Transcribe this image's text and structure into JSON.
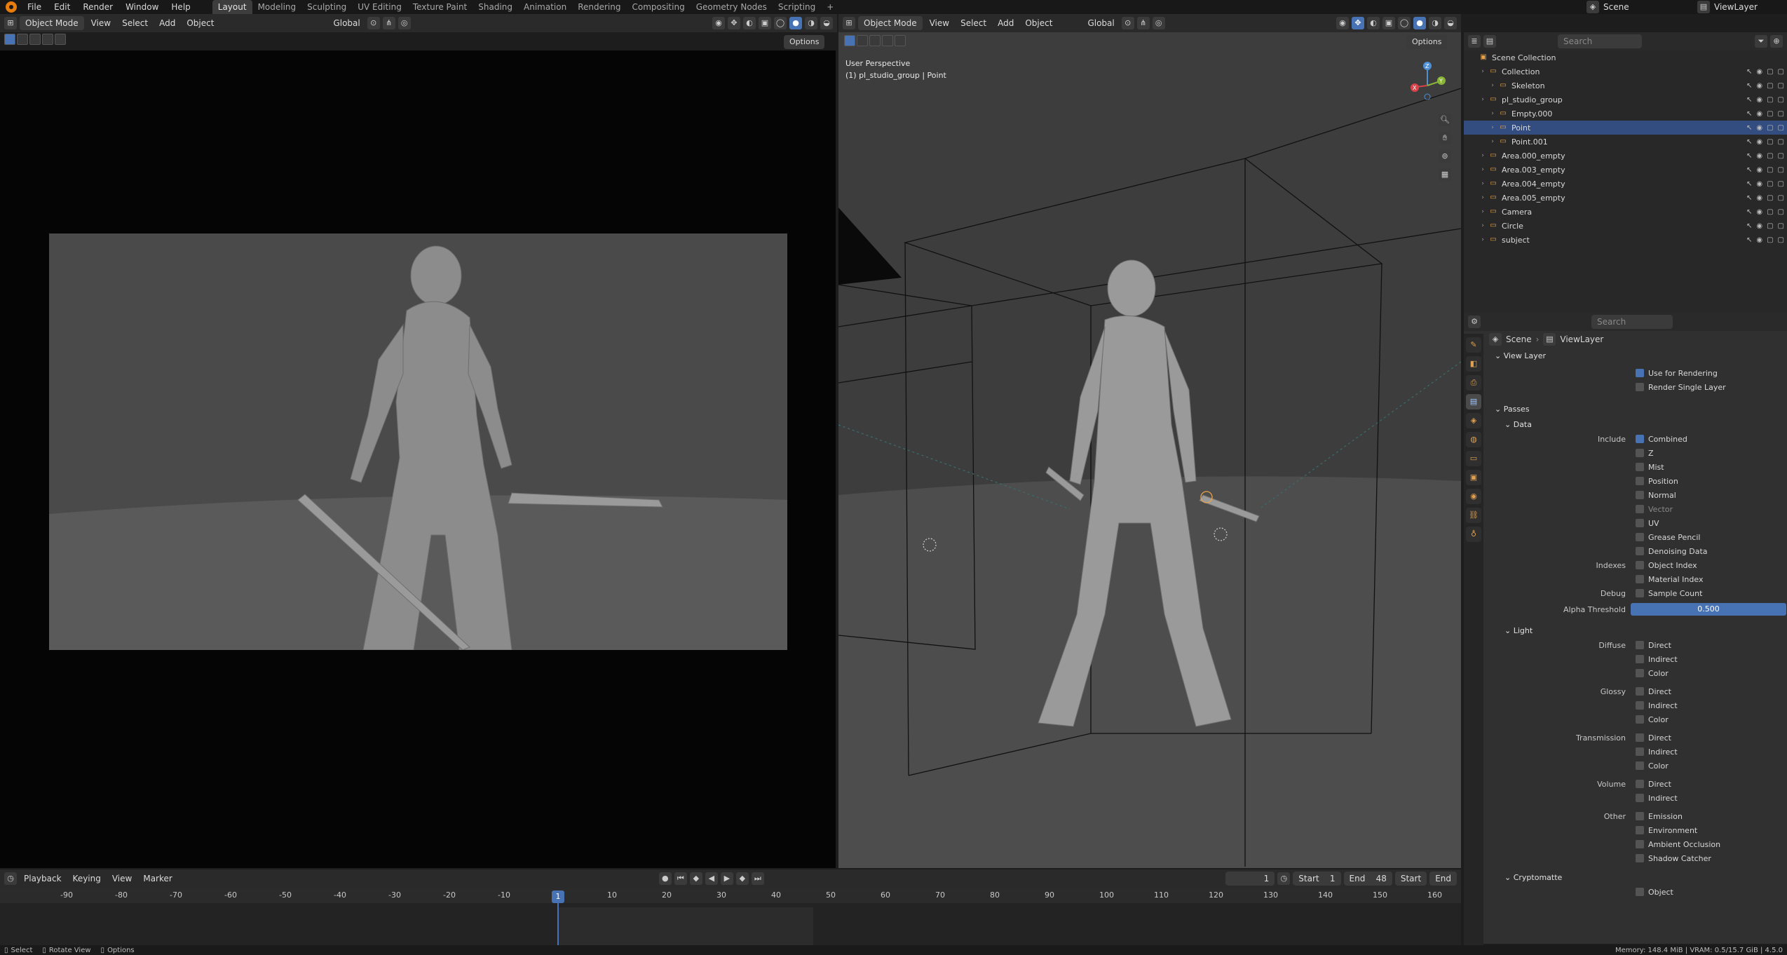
{
  "topbar": {
    "menus": [
      "File",
      "Edit",
      "Render",
      "Window",
      "Help"
    ],
    "workspaces": [
      "Layout",
      "Modeling",
      "Sculpting",
      "UV Editing",
      "Texture Paint",
      "Shading",
      "Animation",
      "Rendering",
      "Compositing",
      "Geometry Nodes",
      "Scripting"
    ],
    "active_workspace": "Layout",
    "add_tab": "+",
    "scene": "Scene",
    "view_layer": "ViewLayer"
  },
  "left_viewport": {
    "mode": "Object Mode",
    "menus": [
      "View",
      "Select",
      "Add",
      "Object"
    ],
    "transform": "Global",
    "options": "Options"
  },
  "right_viewport": {
    "mode": "Object Mode",
    "menus": [
      "View",
      "Select",
      "Add",
      "Object"
    ],
    "transform": "Global",
    "options": "Options",
    "overlay_line1": "User Perspective",
    "overlay_line2": "(1) pl_studio_group | Point",
    "gizmo": {
      "z": "Z",
      "y": "Y",
      "x": "X"
    }
  },
  "outliner": {
    "search_placeholder": "Search",
    "rows": [
      {
        "label": "Scene Collection",
        "indent": 0
      },
      {
        "label": "Collection",
        "indent": 1
      },
      {
        "label": "Skeleton",
        "indent": 2
      },
      {
        "label": "pl_studio_group",
        "indent": 1
      },
      {
        "label": "Empty.000",
        "indent": 2
      },
      {
        "label": "Point",
        "indent": 2,
        "selected": true
      },
      {
        "label": "Point.001",
        "indent": 2
      },
      {
        "label": "Area.000_empty",
        "indent": 1
      },
      {
        "label": "Area.003_empty",
        "indent": 1
      },
      {
        "label": "Area.004_empty",
        "indent": 1
      },
      {
        "label": "Area.005_empty",
        "indent": 1
      },
      {
        "label": "Camera",
        "indent": 1
      },
      {
        "label": "Circle",
        "indent": 1
      },
      {
        "label": "subject",
        "indent": 1
      }
    ]
  },
  "properties": {
    "search_placeholder": "Search",
    "breadcrumb": [
      "Scene",
      "ViewLayer"
    ],
    "view_layer_title": "View Layer",
    "use_for_rendering": "Use for Rendering",
    "render_single_layer": "Render Single Layer",
    "passes_title": "Passes",
    "data_title": "Data",
    "include_label": "Include",
    "data_items": [
      "Combined",
      "Z",
      "Mist",
      "Position",
      "Normal",
      "Vector",
      "UV",
      "Grease Pencil",
      "Denoising Data"
    ],
    "indexes_label": "Indexes",
    "indexes_items": [
      "Object Index",
      "Material Index"
    ],
    "debug_label": "Debug",
    "debug_items": [
      "Sample Count"
    ],
    "alpha_label": "Alpha Threshold",
    "alpha_value": "0.500",
    "light_title": "Light",
    "diffuse_label": "Diffuse",
    "glossy_label": "Glossy",
    "transmission_label": "Transmission",
    "volume_label": "Volume",
    "other_label": "Other",
    "dic": [
      "Direct",
      "Indirect",
      "Color"
    ],
    "di": [
      "Direct",
      "Indirect"
    ],
    "other_items": [
      "Emission",
      "Environment",
      "Ambient Occlusion",
      "Shadow Catcher"
    ],
    "crypto_title": "Cryptomatte",
    "crypto_first": "Object"
  },
  "timeline": {
    "menus": [
      "Playback",
      "Keying",
      "View",
      "Marker"
    ],
    "current_frame": "1",
    "start_label": "Start",
    "start_value": "1",
    "end_label": "End",
    "end_value": "48",
    "start_btn": "Start",
    "end_btn": "End",
    "ticks": [
      "-90",
      "-80",
      "-70",
      "-60",
      "-50",
      "-40",
      "-30",
      "-20",
      "-10",
      "1",
      "10",
      "20",
      "30",
      "40",
      "50",
      "60",
      "70",
      "80",
      "90",
      "100",
      "110",
      "120",
      "130",
      "140",
      "150",
      "160"
    ]
  },
  "status": {
    "select": "Select",
    "rotate": "Rotate View",
    "options": "Options",
    "memory": "Memory: 148.4 MiB | VRAM: 0.5/15.7 GiB | 4.5.0"
  }
}
